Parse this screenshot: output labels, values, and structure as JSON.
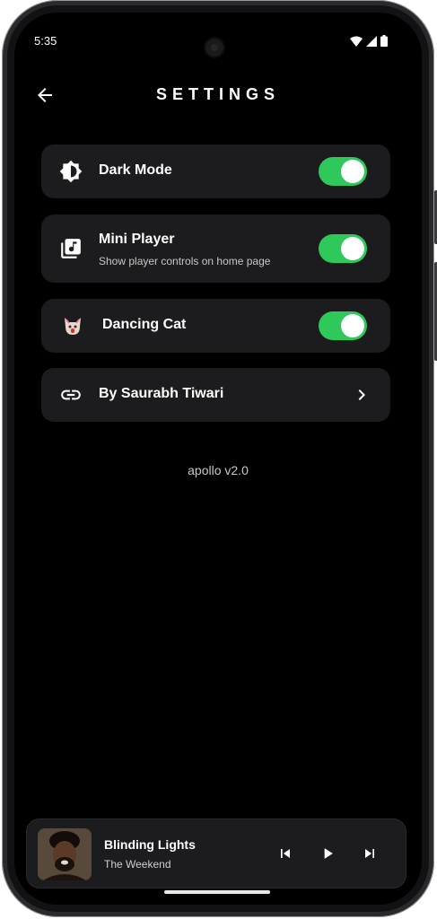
{
  "status_bar": {
    "time": "5:35",
    "icons": [
      "wifi-icon",
      "signal-icon",
      "battery-icon"
    ]
  },
  "header": {
    "title": "SETTINGS",
    "back_icon": "arrow-left-icon"
  },
  "settings": [
    {
      "label": "Dark Mode",
      "icon": "brightness-icon",
      "toggle_on": true
    },
    {
      "label": "Mini Player",
      "subtitle": "Show player controls on home page",
      "icon": "library-music-icon",
      "toggle_on": true
    },
    {
      "label": "Dancing Cat",
      "icon": "cat-icon",
      "toggle_on": true
    },
    {
      "label": "By Saurabh Tiwari",
      "icon": "link-icon",
      "trailing_icon": "chevron-right-icon"
    }
  ],
  "version": "apollo v2.0",
  "mini_player": {
    "title": "Blinding Lights",
    "artist": "The Weekend",
    "controls": [
      "skip-previous-icon",
      "play-icon",
      "skip-next-icon"
    ]
  },
  "colors": {
    "background": "#000000",
    "card": "#1c1c1e",
    "toggle_on": "#2fc85a"
  }
}
